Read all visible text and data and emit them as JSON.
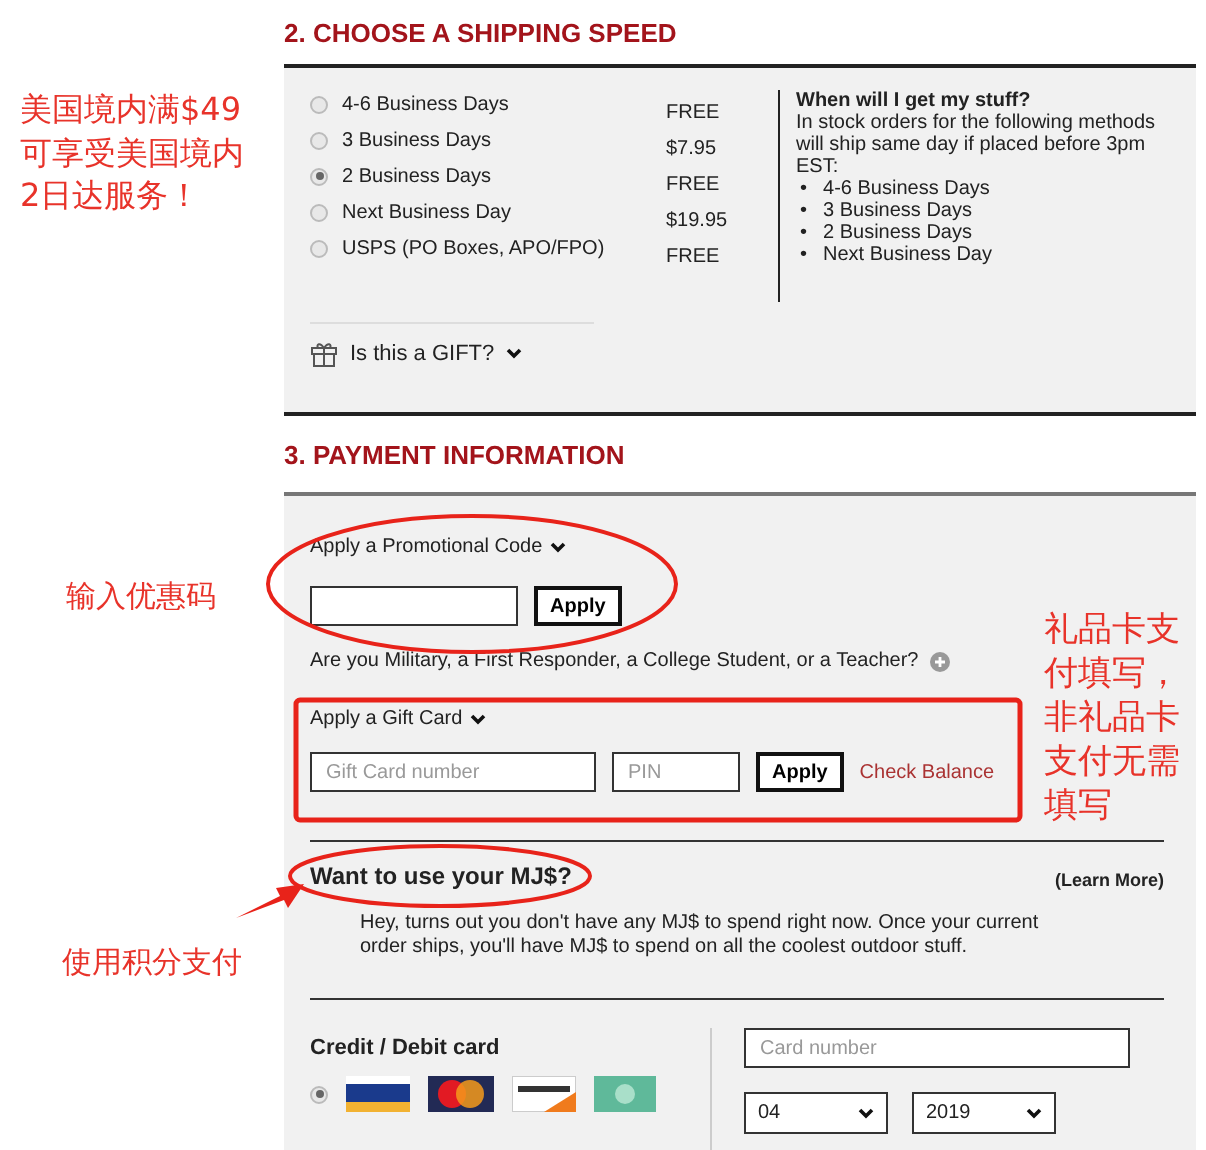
{
  "shipping": {
    "title": "2. CHOOSE A SHIPPING SPEED",
    "options": [
      {
        "label": "4-6 Business Days",
        "price": "FREE",
        "selected": false
      },
      {
        "label": "3 Business Days",
        "price": "$7.95",
        "selected": false
      },
      {
        "label": "2 Business Days",
        "price": "FREE",
        "selected": true
      },
      {
        "label": "Next Business Day",
        "price": "$19.95",
        "selected": false
      },
      {
        "label": "USPS (PO Boxes, APO/FPO)",
        "price": "FREE",
        "selected": false
      }
    ],
    "info": {
      "title": "When will I get my stuff?",
      "lines": [
        "In stock orders for the following methods",
        "will ship same day if placed before 3pm EST:"
      ],
      "items": [
        {
          "bullet": "•",
          "text": "4-6 Business Days"
        },
        {
          "bullet": "•",
          "text": "3 Business Days"
        },
        {
          "bullet": "•",
          "text": "2 Business Days"
        },
        {
          "bullet": "•",
          "text": "Next Business Day"
        }
      ]
    },
    "gift_toggle": "Is this a GIFT?"
  },
  "payment": {
    "title": "3. PAYMENT INFORMATION",
    "promo": {
      "label": "Apply a Promotional Code",
      "button": "Apply"
    },
    "military": "Are you Military, a First Responder, a College Student, or a Teacher?",
    "gift_card": {
      "label": "Apply a Gift Card",
      "number_placeholder": "Gift Card number",
      "pin_placeholder": "PIN",
      "button": "Apply",
      "check_balance": "Check Balance"
    },
    "mj": {
      "title": "Want to use your MJ$?",
      "learn_more": "(Learn More)",
      "text": "Hey, turns out you don't have any MJ$ to spend right now. Once your current order ships, you'll have MJ$ to spend on all the coolest outdoor stuff."
    },
    "credit": {
      "title": "Credit / Debit card",
      "selected": true,
      "card_number_placeholder": "Card number",
      "month": "04",
      "year": "2019"
    }
  },
  "annotations": [
    "美国境内满$49可享受美国境内2日达服务！",
    "输入优惠码",
    "礼品卡支付填写，非礼品卡支付无需填写",
    "使用积分支付"
  ]
}
